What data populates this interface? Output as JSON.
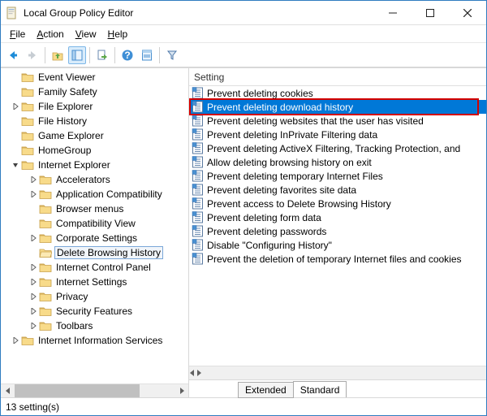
{
  "window": {
    "title": "Local Group Policy Editor"
  },
  "menu": {
    "file": "File",
    "action": "Action",
    "view": "View",
    "help": "Help"
  },
  "tree": {
    "items": [
      {
        "level": 1,
        "exp": "",
        "icon": "folder",
        "label": "Event Viewer"
      },
      {
        "level": 1,
        "exp": "",
        "icon": "folder",
        "label": "Family Safety"
      },
      {
        "level": 1,
        "exp": "r",
        "icon": "folder",
        "label": "File Explorer"
      },
      {
        "level": 1,
        "exp": "",
        "icon": "folder",
        "label": "File History"
      },
      {
        "level": 1,
        "exp": "",
        "icon": "folder",
        "label": "Game Explorer"
      },
      {
        "level": 1,
        "exp": "",
        "icon": "folder",
        "label": "HomeGroup"
      },
      {
        "level": 1,
        "exp": "d",
        "icon": "folder",
        "label": "Internet Explorer"
      },
      {
        "level": 2,
        "exp": "r",
        "icon": "folder",
        "label": "Accelerators"
      },
      {
        "level": 2,
        "exp": "r",
        "icon": "folder",
        "label": "Application Compatibility"
      },
      {
        "level": 2,
        "exp": "",
        "icon": "folder",
        "label": "Browser menus"
      },
      {
        "level": 2,
        "exp": "",
        "icon": "folder",
        "label": "Compatibility View"
      },
      {
        "level": 2,
        "exp": "r",
        "icon": "folder",
        "label": "Corporate Settings"
      },
      {
        "level": 2,
        "exp": "",
        "icon": "folder-open",
        "label": "Delete Browsing History",
        "selected": true
      },
      {
        "level": 2,
        "exp": "r",
        "icon": "folder",
        "label": "Internet Control Panel"
      },
      {
        "level": 2,
        "exp": "r",
        "icon": "folder",
        "label": "Internet Settings"
      },
      {
        "level": 2,
        "exp": "r",
        "icon": "folder",
        "label": "Privacy"
      },
      {
        "level": 2,
        "exp": "r",
        "icon": "folder",
        "label": "Security Features"
      },
      {
        "level": 2,
        "exp": "r",
        "icon": "folder",
        "label": "Toolbars"
      },
      {
        "level": 1,
        "exp": "r",
        "icon": "folder",
        "label": "Internet Information Services"
      }
    ]
  },
  "list": {
    "header": "Setting",
    "items": [
      {
        "label": "Prevent deleting cookies"
      },
      {
        "label": "Prevent deleting download history",
        "selected": true
      },
      {
        "label": "Prevent deleting websites that the user has visited"
      },
      {
        "label": "Prevent deleting InPrivate Filtering data"
      },
      {
        "label": "Prevent deleting ActiveX Filtering, Tracking Protection, and"
      },
      {
        "label": "Allow deleting browsing history on exit"
      },
      {
        "label": "Prevent deleting temporary Internet Files"
      },
      {
        "label": "Prevent deleting favorites site data"
      },
      {
        "label": "Prevent access to Delete Browsing History"
      },
      {
        "label": "Prevent deleting form data"
      },
      {
        "label": "Prevent deleting passwords"
      },
      {
        "label": "Disable \"Configuring History\""
      },
      {
        "label": "Prevent the deletion of temporary Internet files and cookies"
      }
    ]
  },
  "tabs": {
    "extended": "Extended",
    "standard": "Standard"
  },
  "status": {
    "text": "13 setting(s)"
  }
}
